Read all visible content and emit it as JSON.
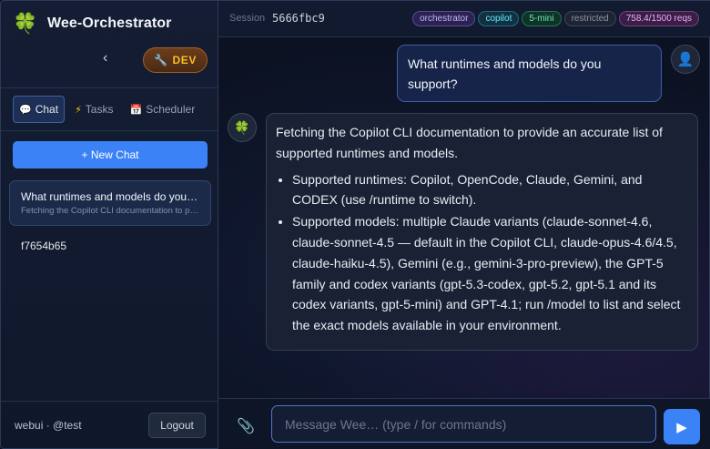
{
  "app": {
    "title": "Wee-Orchestrator",
    "logo_icon": "clover-icon",
    "env_badge": "DEV"
  },
  "sidebar": {
    "tabs": [
      {
        "label": "Chat",
        "icon": "chat-bubble-icon",
        "active": true
      },
      {
        "label": "Tasks",
        "icon": "lightning-icon",
        "active": false
      },
      {
        "label": "Scheduler",
        "icon": "calendar-icon",
        "active": false
      }
    ],
    "new_chat_label": "+ New Chat",
    "chats": [
      {
        "title": "What runtimes and models do you support?",
        "preview": "Fetching the Copilot CLI documentation to provide an accurate list",
        "active": true
      },
      {
        "title": "f7654b65",
        "preview": "",
        "active": false
      }
    ],
    "user_label": "webui · @test",
    "logout_label": "Logout"
  },
  "header": {
    "session_label": "Session",
    "session_id": "5666fbc9",
    "pills": [
      "orchestrator",
      "copilot",
      "5-mini",
      "restricted",
      "758.4/1500 reqs"
    ]
  },
  "messages": {
    "user": "What runtimes and models do you support?",
    "assistant_intro": "Fetching the Copilot CLI documentation to provide an accurate list of supported runtimes and models.",
    "assistant_bullets": [
      "Supported runtimes: Copilot, OpenCode, Claude, Gemini, and CODEX (use /runtime to switch).",
      "Supported models: multiple Claude variants (claude-sonnet-4.6, claude-sonnet-4.5 — default in the Copilot CLI, claude-opus-4.6/4.5, claude-haiku-4.5), Gemini (e.g., gemini-3-pro-preview), the GPT-5 family and codex variants (gpt-5.3-codex, gpt-5.2, gpt-5.1 and its codex variants, gpt-5-mini) and GPT-4.1; run /model to list and select the exact models available in your environment."
    ]
  },
  "composer": {
    "placeholder": "Message Wee… (type / for commands)",
    "value": ""
  },
  "colors": {
    "accent": "#3b82f6",
    "dev_badge_text": "#fbbf24"
  }
}
